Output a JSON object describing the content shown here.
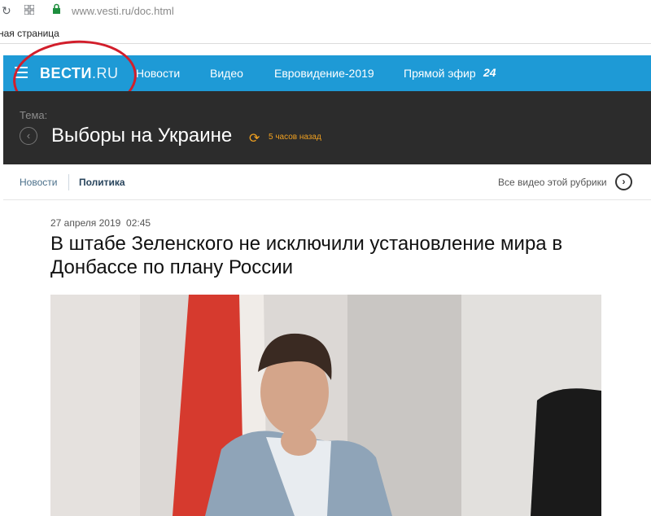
{
  "browser": {
    "url": "www.vesti.ru/doc.html",
    "bookmark": "ная страница"
  },
  "site": {
    "logo_main": "ВЕСТИ",
    "logo_suffix": ".RU",
    "nav": [
      "Новости",
      "Видео",
      "Евровидение-2019",
      "Прямой эфир"
    ],
    "live_badge": "24",
    "accent": "#1e9ad6"
  },
  "topic": {
    "label": "Тема:",
    "title": "Выборы на Украине",
    "updated": "5 часов назад"
  },
  "subnav": {
    "items": [
      "Новости",
      "Политика"
    ],
    "all_video": "Все видео этой рубрики"
  },
  "article": {
    "date": "27 апреля 2019",
    "time": "02:45",
    "title": "В штабе Зеленского не исключили установление мира в Донбассе по плану России"
  }
}
